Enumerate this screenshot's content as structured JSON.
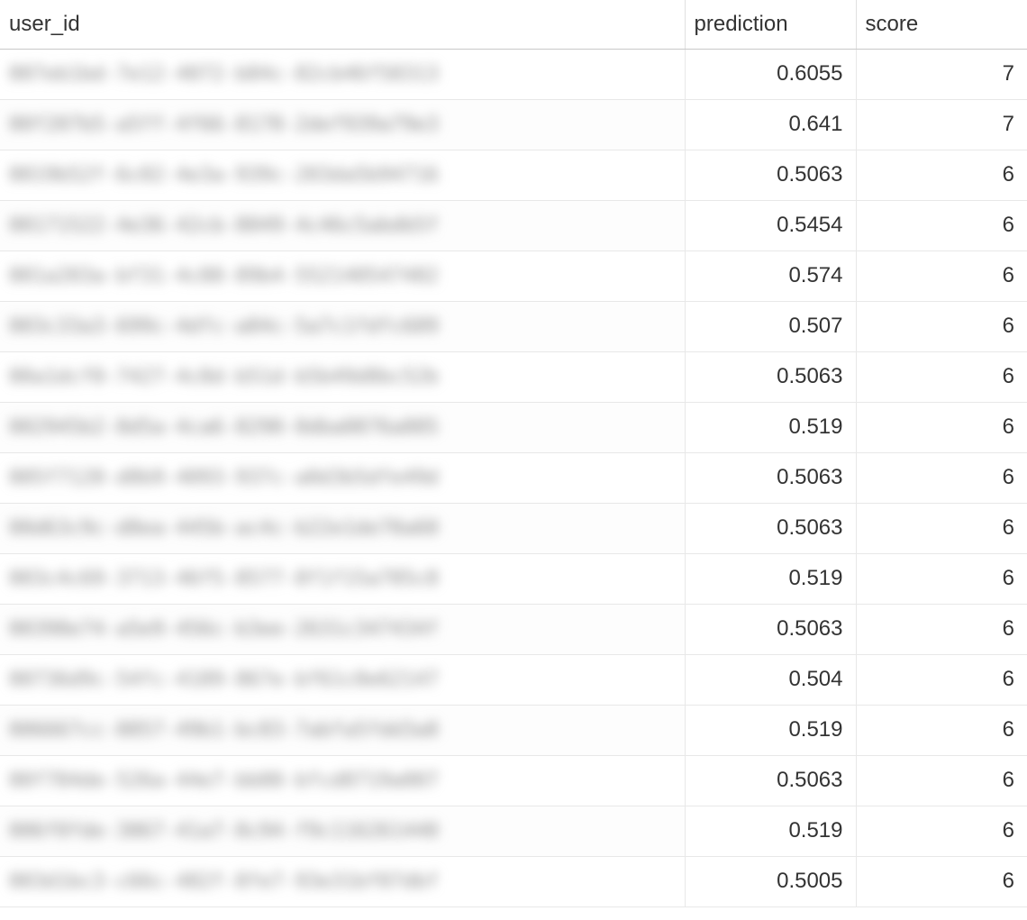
{
  "table": {
    "columns": {
      "user_id": "user_id",
      "prediction": "prediction",
      "score": "score"
    },
    "rows": [
      {
        "user_id": "007eb1bd-7e12-4072-b84c-82cb46f58313",
        "prediction": "0.6055",
        "score": "7"
      },
      {
        "user_id": "00f207b5-a5ff-4f66-8178-2def939a79e3",
        "prediction": "0.641",
        "score": "7"
      },
      {
        "user_id": "0019b52f-6c02-4e3a-939c-203da5b94716",
        "prediction": "0.5063",
        "score": "6"
      },
      {
        "user_id": "00171522-4e36-42cb-8049-4c46c5abdb5f",
        "prediction": "0.5454",
        "score": "6"
      },
      {
        "user_id": "001a203a-bf31-4c88-89b4-552140547482",
        "prediction": "0.574",
        "score": "6"
      },
      {
        "user_id": "003c33a3-699c-4dfc-a84c-5a7c1fdfc689",
        "prediction": "0.507",
        "score": "6"
      },
      {
        "user_id": "00a1dcf0-7427-4c8d-b51d-b5b49d8bc52b",
        "prediction": "0.5063",
        "score": "6"
      },
      {
        "user_id": "002945b2-8d5a-4ca6-8290-0dba0876a885",
        "prediction": "0.519",
        "score": "6"
      },
      {
        "user_id": "005f7128-d8b9-4093-937c-a0d3b5dfe49d",
        "prediction": "0.5063",
        "score": "6"
      },
      {
        "user_id": "00d63c9c-d8ea-445b-ac4c-b22e1de70a60",
        "prediction": "0.5063",
        "score": "6"
      },
      {
        "user_id": "003c4c69-3713-46f5-8577-8f1f15a785c8",
        "prediction": "0.519",
        "score": "6"
      },
      {
        "user_id": "00398e74-a5e9-456c-b3ee-2631c347434f",
        "prediction": "0.5063",
        "score": "6"
      },
      {
        "user_id": "00736d9c-54fc-4189-867e-bf61c0e62147",
        "prediction": "0.504",
        "score": "6"
      },
      {
        "user_id": "006667cc-8857-49b1-bc83-7abfa5fdd3a8",
        "prediction": "0.519",
        "score": "6"
      },
      {
        "user_id": "00f784de-526a-44e7-bb80-bfcd8719a007",
        "prediction": "0.5063",
        "score": "6"
      },
      {
        "user_id": "006f0fde-3867-41a7-8c94-f9c116261440",
        "prediction": "0.519",
        "score": "6"
      },
      {
        "user_id": "003d1bc3-c66c-482f-8fe7-93e31bf07dbf",
        "prediction": "0.5005",
        "score": "6"
      }
    ]
  }
}
